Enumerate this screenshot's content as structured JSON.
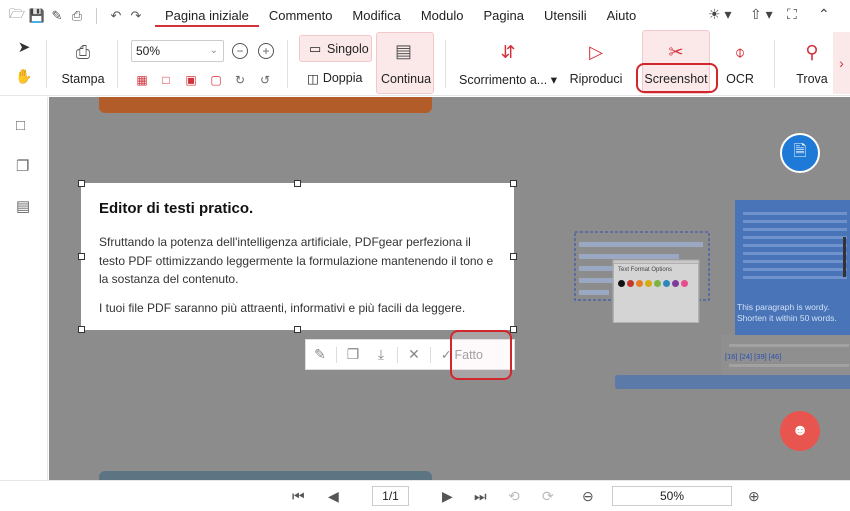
{
  "menubar": {
    "quick_icons": [
      "open-folder-icon",
      "save-icon",
      "save-as-icon",
      "print-icon",
      "undo-icon",
      "redo-icon"
    ],
    "items": [
      {
        "label": "Pagina iniziale",
        "active": true
      },
      {
        "label": "Commento"
      },
      {
        "label": "Modifica"
      },
      {
        "label": "Modulo"
      },
      {
        "label": "Pagina"
      },
      {
        "label": "Utensili"
      },
      {
        "label": "Aiuto"
      }
    ]
  },
  "ribbon": {
    "print_label": "Stampa",
    "zoom_value": "50%",
    "single_label": "Singolo",
    "double_label": "Doppia",
    "continuous_label": "Continua",
    "scroll_label": "Scorrimento a...",
    "play_label": "Riproduci",
    "screenshot_label": "Screenshot",
    "ocr_label": "OCR",
    "find_label": "Trova"
  },
  "textbox": {
    "title": "Editor di testi pratico.",
    "para1": "Sfruttando la potenza dell'intelligenza artificiale, PDFgear perfeziona il testo PDF ottimizzando leggermente la formulazione mantenendo il tono e la sostanza del contenuto.",
    "para2": "I tuoi file PDF saranno più attraenti, informativi e più facili da leggere."
  },
  "floating_toolbar": {
    "done_label": "Fatto"
  },
  "preview": {
    "popup_title": "Text Format Options",
    "panel_text": "This paragraph is wordy. Shorten it within 50 words.",
    "refs": "[16] [24] [39] [46]"
  },
  "statusbar": {
    "page": "1/1",
    "zoom": "50%"
  },
  "colors": {
    "accent": "#d2323b",
    "doc_bg": "#8c8c8c",
    "word_button": "#1e7ad6",
    "bot_button": "#e8554e"
  }
}
